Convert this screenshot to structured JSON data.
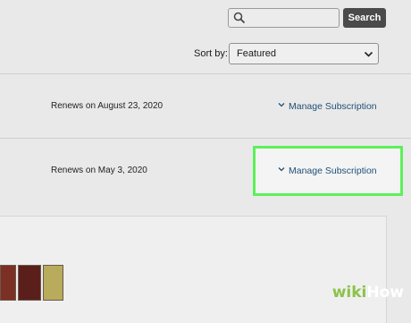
{
  "search": {
    "value": "",
    "placeholder": "",
    "button_label": "Search"
  },
  "sort": {
    "label": "Sort by:",
    "selected": "Featured"
  },
  "subscriptions": [
    {
      "renewal": "Renews on August 23, 2020",
      "manage_label": "Manage Subscription"
    },
    {
      "renewal": "Renews on May 3, 2020",
      "manage_label": "Manage Subscription"
    }
  ],
  "highlight_color": "#5cf05a",
  "book_covers": [
    {
      "color": "#7c2f24",
      "icon": "book-cover-red"
    },
    {
      "color": "#5a1f1a",
      "icon": "book-cover-dark-red"
    },
    {
      "color": "#b8ab5c",
      "icon": "book-cover-olive"
    }
  ],
  "watermark": {
    "prefix": "wiki",
    "suffix": "How"
  }
}
